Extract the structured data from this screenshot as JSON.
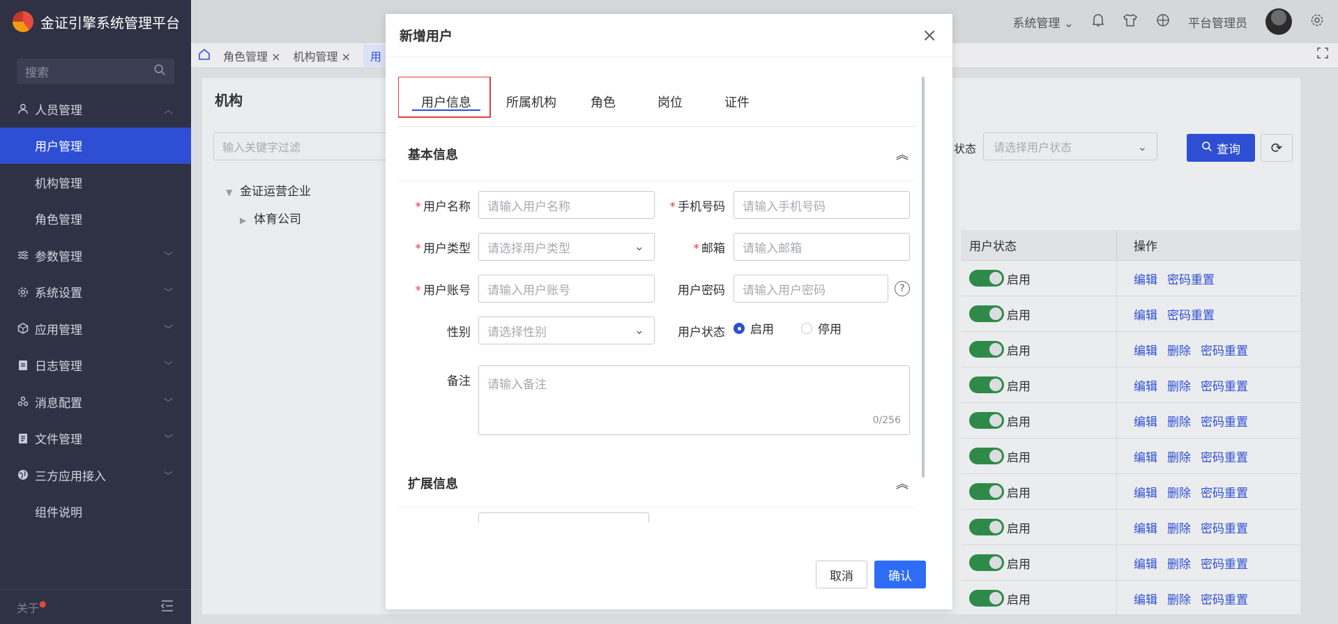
{
  "app": {
    "title": "金证引擎系统管理平台",
    "search_placeholder": "搜索",
    "footer_about": "关于",
    "footer_dot": "●"
  },
  "sidebar": {
    "items": [
      {
        "label": "人员管理",
        "icon": "user-icon",
        "chevron": "︿"
      },
      {
        "label": "用户管理"
      },
      {
        "label": "机构管理"
      },
      {
        "label": "角色管理"
      },
      {
        "label": "参数管理",
        "icon": "sliders-icon",
        "chevron": "﹀"
      },
      {
        "label": "系统设置",
        "icon": "gear-icon",
        "chevron": "﹀"
      },
      {
        "label": "应用管理",
        "icon": "cube-icon",
        "chevron": "﹀"
      },
      {
        "label": "日志管理",
        "icon": "document-icon",
        "chevron": "﹀"
      },
      {
        "label": "消息配置",
        "icon": "nodes-icon",
        "chevron": "﹀"
      },
      {
        "label": "文件管理",
        "icon": "file-icon",
        "chevron": "﹀"
      },
      {
        "label": "三方应用接入",
        "icon": "globe-icon",
        "chevron": "﹀"
      },
      {
        "label": "组件说明"
      }
    ]
  },
  "topbar": {
    "system_menu": "系统管理",
    "user_name": "平台管理员"
  },
  "tabs_bar": {
    "tabs": [
      "角色管理",
      "机构管理",
      "用"
    ]
  },
  "background_page": {
    "org_title": "机构",
    "org_filter_placeholder": "输入关键字过滤",
    "tree": [
      "金证运营企业",
      "体育公司"
    ],
    "status_label": "状态",
    "status_placeholder": "请选择用户状态",
    "query_label": "查询",
    "table_headers": [
      "用户状态",
      "操作"
    ],
    "rows": [
      {
        "status": "启用",
        "actions": [
          "编辑",
          "密码重置"
        ]
      },
      {
        "status": "启用",
        "actions": [
          "编辑",
          "密码重置"
        ]
      },
      {
        "status": "启用",
        "actions": [
          "编辑",
          "删除",
          "密码重置"
        ]
      },
      {
        "status": "启用",
        "actions": [
          "编辑",
          "删除",
          "密码重置"
        ]
      },
      {
        "status": "启用",
        "actions": [
          "编辑",
          "删除",
          "密码重置"
        ]
      },
      {
        "status": "启用",
        "actions": [
          "编辑",
          "删除",
          "密码重置"
        ]
      },
      {
        "status": "启用",
        "actions": [
          "编辑",
          "删除",
          "密码重置"
        ]
      },
      {
        "status": "启用",
        "actions": [
          "编辑",
          "删除",
          "密码重置"
        ]
      },
      {
        "status": "启用",
        "actions": [
          "编辑",
          "删除",
          "密码重置"
        ]
      },
      {
        "status": "启用",
        "actions": [
          "编辑",
          "删除",
          "密码重置"
        ]
      }
    ]
  },
  "dialog": {
    "title": "新增用户",
    "close_glyph": "×",
    "tabs": [
      "用户信息",
      "所属机构",
      "角色",
      "岗位",
      "证件"
    ],
    "section_basic": "基本信息",
    "section_extend": "扩展信息",
    "collapse_glyph": "︽",
    "fields": {
      "username": {
        "label": "用户名称",
        "placeholder": "请输入用户名称"
      },
      "phone": {
        "label": "手机号码",
        "placeholder": "请输入手机号码"
      },
      "usertype": {
        "label": "用户类型",
        "placeholder": "请选择用户类型"
      },
      "email": {
        "label": "邮箱",
        "placeholder": "请输入邮箱"
      },
      "account": {
        "label": "用户账号",
        "placeholder": "请输入用户账号"
      },
      "password": {
        "label": "用户密码",
        "placeholder": "请输入用户密码"
      },
      "gender": {
        "label": "性别",
        "placeholder": "请选择性别"
      },
      "status": {
        "label": "用户状态",
        "options": [
          "启用",
          "停用"
        ],
        "selected": "启用"
      },
      "remark": {
        "label": "备注",
        "placeholder": "请输入备注",
        "counter": "0/256"
      }
    },
    "required_mark": "*",
    "help_glyph": "?",
    "cancel_label": "取消",
    "confirm_label": "确认"
  },
  "colors": {
    "primary": "#2e4fd4",
    "confirm": "#2e6cf6",
    "highlight_border": "#e23b3b",
    "sidebar_bg": "#2f3245",
    "switch_on": "#2f8a4a"
  }
}
